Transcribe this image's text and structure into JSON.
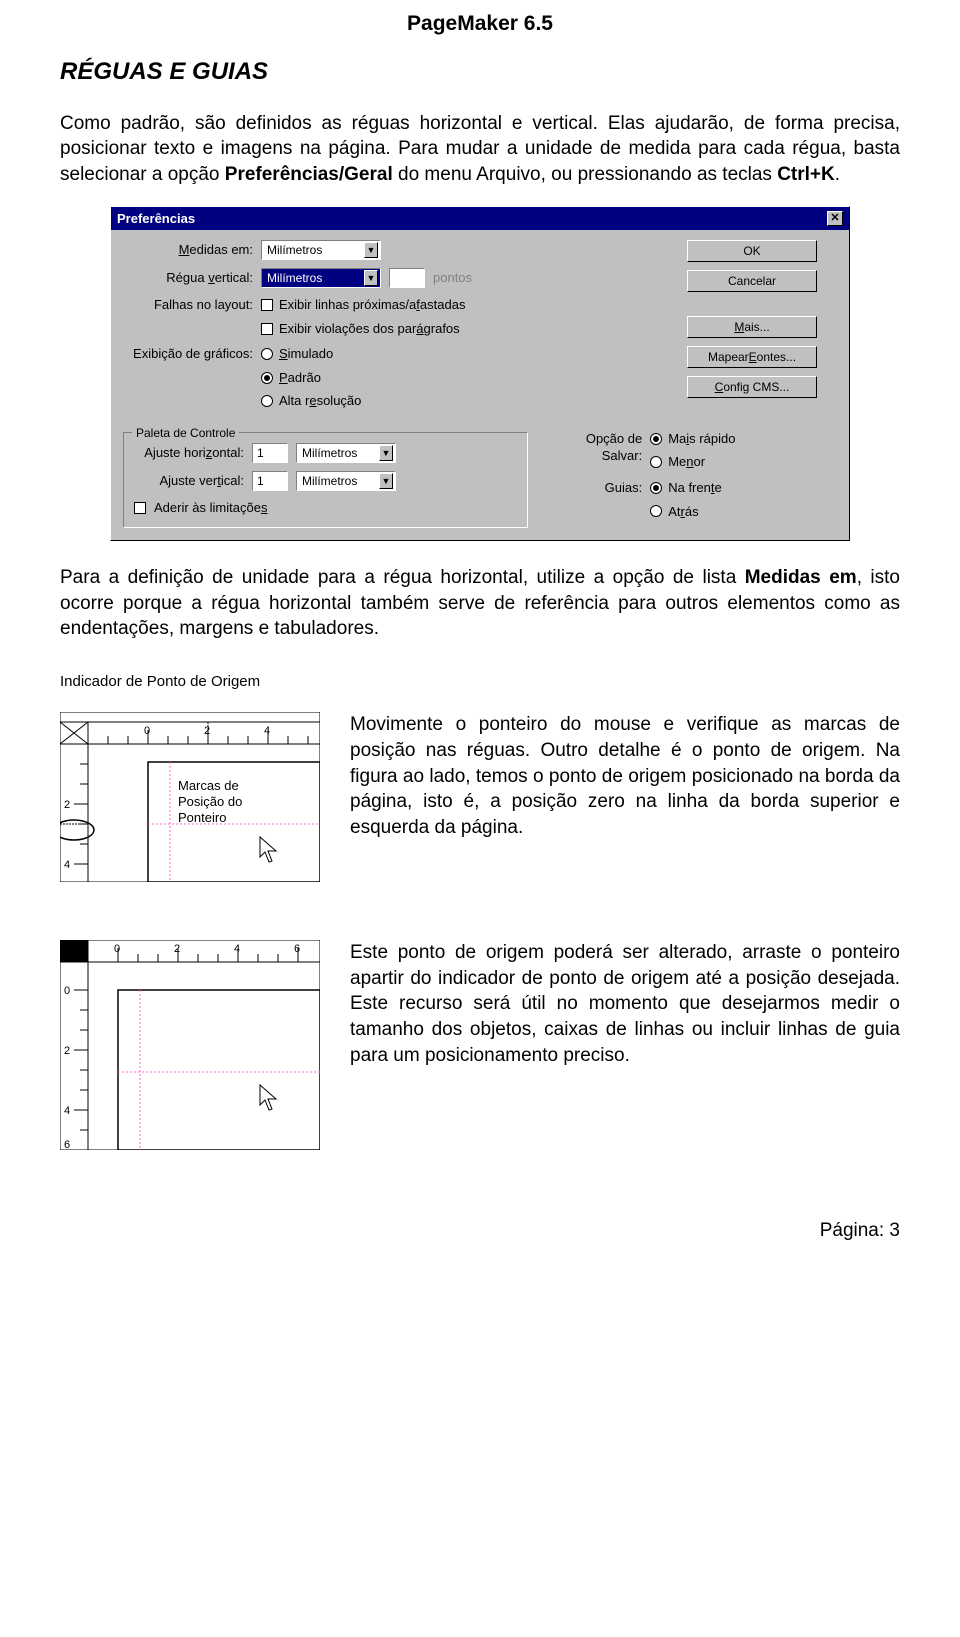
{
  "header": "PageMaker 6.5",
  "title": "RÉGUAS E GUIAS",
  "para1_a": "Como padrão, são definidos as réguas horizontal e vertical. Elas ajudarão, de forma precisa, posicionar texto e imagens na página. Para mudar a unidade de medida para cada régua, basta selecionar a opção ",
  "para1_b": "Preferências/Geral",
  "para1_c": " do menu Arquivo, ou pressionando as teclas ",
  "para1_d": "Ctrl+K",
  "para1_e": ".",
  "dialog": {
    "title": "Preferências",
    "measures_lbl": "Medidas em:",
    "measures_val": "Milímetros",
    "vruler_lbl": "Régua vertical:",
    "vruler_val": "Milímetros",
    "points_lbl": "pontos",
    "faults_lbl": "Falhas no layout:",
    "cb1": "Exibir linhas próximas/afastadas",
    "cb2": "Exibir violações dos parágrafos",
    "gfx_lbl": "Exibição de gráficos:",
    "gfx1": "Simulado",
    "gfx2": "Padrão",
    "gfx3": "Alta resolução",
    "btn_ok": "OK",
    "btn_cancel": "Cancelar",
    "btn_more": "Mais...",
    "btn_fonts": "Mapear Eontes...",
    "btn_cms": "Config CMS...",
    "palette_legend": "Paleta de Controle",
    "hsnap_lbl": "Ajuste horizontal:",
    "hsnap_val": "1",
    "hsnap_unit": "Milímetros",
    "vsnap_lbl": "Ajuste vertical:",
    "vsnap_val": "1",
    "vsnap_unit": "Milímetros",
    "snap_cb": "Aderir às limitações",
    "save_lbl": "Opção de Salvar:",
    "save1": "Mais rápido",
    "save2": "Menor",
    "guides_lbl": "Guias:",
    "guides1": "Na frente",
    "guides2": "Atrás"
  },
  "para2_a": "Para a definição de unidade para a régua horizontal, utilize a opção de lista ",
  "para2_b": "Medidas em",
  "para2_c": ", isto ocorre porque a régua horizontal também serve de referência para outros elementos como as endentações, margens e tabuladores.",
  "fig1": {
    "caption": "Indicador de Ponto de Origem",
    "label1": "Marcas de",
    "label2": "Posição do",
    "label3": "Ponteiro",
    "ticks": [
      "0",
      "2",
      "4"
    ],
    "vticks": [
      "2",
      "4"
    ]
  },
  "para3": "Movimente o ponteiro do mouse e verifique as marcas de posição nas réguas. Outro detalhe é o ponto de origem. Na figura ao lado, temos o ponto de origem posicionado na borda da página, isto é, a posição zero na linha da borda superior e esquerda da página.",
  "fig2": {
    "ticks": [
      "0",
      "2",
      "4",
      "6"
    ],
    "vticks": [
      "0",
      "2",
      "4",
      "6"
    ]
  },
  "para4": "Este ponto de origem poderá ser alterado, arraste o ponteiro apartir do indicador de ponto de origem até a posição desejada. Este recurso será útil no momento que desejarmos medir o tamanho dos objetos, caixas de linhas ou incluir linhas de guia para um posicionamento preciso.",
  "footer": "Página: 3"
}
